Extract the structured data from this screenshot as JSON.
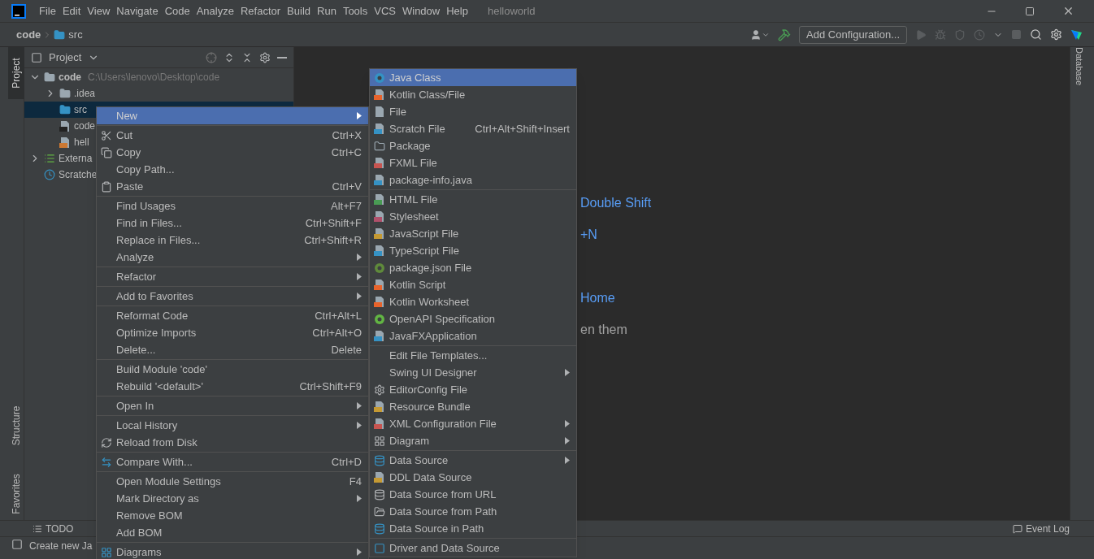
{
  "title_bar": {
    "menus": [
      "File",
      "Edit",
      "View",
      "Navigate",
      "Code",
      "Analyze",
      "Refactor",
      "Build",
      "Run",
      "Tools",
      "VCS",
      "Window",
      "Help"
    ],
    "title": "helloworld"
  },
  "nav_bar": {
    "breadcrumbs": [
      "code",
      "src"
    ],
    "run_config": "Add Configuration..."
  },
  "left_stripe": [
    {
      "label": "Project",
      "selected": true
    },
    {
      "label": "Structure",
      "selected": false
    },
    {
      "label": "Favorites",
      "selected": false
    }
  ],
  "right_stripe": [
    {
      "label": "Database",
      "selected": false
    }
  ],
  "project_panel": {
    "title": "Project",
    "tree": [
      {
        "kind": "module",
        "label": "code",
        "path": "C:\\Users\\lenovo\\Desktop\\code",
        "expanded": true,
        "selected": false,
        "children": [
          {
            "kind": "folder",
            "label": ".idea",
            "expanded": false,
            "selected": false
          },
          {
            "kind": "source",
            "label": "src",
            "selected": true
          },
          {
            "kind": "iml",
            "label": "code",
            "selected": false
          },
          {
            "kind": "java",
            "label": "hell",
            "selected": false
          }
        ]
      },
      {
        "kind": "libraries",
        "label": "Externa",
        "expanded": false,
        "selected": false
      },
      {
        "kind": "scratches",
        "label": "Scratche",
        "selected": false
      }
    ]
  },
  "editor_hints": [
    {
      "kind": "shortcut",
      "text": "Double Shift"
    },
    {
      "kind": "shortcut",
      "text": "+N"
    },
    {
      "kind": "shortcut",
      "text": "Home"
    },
    {
      "kind": "plain",
      "text": "en them"
    }
  ],
  "bottom_bar": {
    "tabs": [
      "TODO"
    ],
    "event_log": "Event Log"
  },
  "status_bar": {
    "message": "Create new Ja"
  },
  "context_menu": {
    "groups": [
      [
        {
          "label": "New",
          "submenu": true,
          "selected": true
        }
      ],
      [
        {
          "label": "Cut",
          "shortcut": "Ctrl+X",
          "selected": false
        },
        {
          "label": "Copy",
          "shortcut": "Ctrl+C",
          "selected": false
        },
        {
          "label": "Copy Path...",
          "selected": false
        },
        {
          "label": "Paste",
          "shortcut": "Ctrl+V",
          "selected": false
        }
      ],
      [
        {
          "label": "Find Usages",
          "shortcut": "Alt+F7",
          "selected": false
        },
        {
          "label": "Find in Files...",
          "shortcut": "Ctrl+Shift+F",
          "selected": false
        },
        {
          "label": "Replace in Files...",
          "shortcut": "Ctrl+Shift+R",
          "selected": false
        },
        {
          "label": "Analyze",
          "submenu": true,
          "selected": false
        }
      ],
      [
        {
          "label": "Refactor",
          "submenu": true,
          "selected": false
        }
      ],
      [
        {
          "label": "Add to Favorites",
          "submenu": true,
          "selected": false
        }
      ],
      [
        {
          "label": "Reformat Code",
          "shortcut": "Ctrl+Alt+L",
          "selected": false
        },
        {
          "label": "Optimize Imports",
          "shortcut": "Ctrl+Alt+O",
          "selected": false
        },
        {
          "label": "Delete...",
          "shortcut": "Delete",
          "selected": false
        }
      ],
      [
        {
          "label": "Build Module 'code'",
          "selected": false
        },
        {
          "label": "Rebuild '<default>'",
          "shortcut": "Ctrl+Shift+F9",
          "selected": false
        }
      ],
      [
        {
          "label": "Open In",
          "submenu": true,
          "selected": false
        }
      ],
      [
        {
          "label": "Local History",
          "submenu": true,
          "selected": false
        },
        {
          "label": "Reload from Disk",
          "selected": false
        }
      ],
      [
        {
          "label": "Compare With...",
          "shortcut": "Ctrl+D",
          "selected": false
        }
      ],
      [
        {
          "label": "Open Module Settings",
          "shortcut": "F4",
          "selected": false
        },
        {
          "label": "Mark Directory as",
          "submenu": true,
          "selected": false
        },
        {
          "label": "Remove BOM",
          "selected": false
        },
        {
          "label": "Add BOM",
          "selected": false
        }
      ],
      [
        {
          "label": "Diagrams",
          "submenu": true,
          "selected": false
        }
      ]
    ]
  },
  "new_submenu": {
    "groups": [
      [
        {
          "label": "Java Class",
          "selected": true
        },
        {
          "label": "Kotlin Class/File",
          "selected": false
        },
        {
          "label": "File",
          "selected": false
        },
        {
          "label": "Scratch File",
          "shortcut": "Ctrl+Alt+Shift+Insert",
          "selected": false
        },
        {
          "label": "Package",
          "selected": false
        },
        {
          "label": "FXML File",
          "selected": false
        },
        {
          "label": "package-info.java",
          "selected": false
        }
      ],
      [
        {
          "label": "HTML File",
          "selected": false
        },
        {
          "label": "Stylesheet",
          "selected": false
        },
        {
          "label": "JavaScript File",
          "selected": false
        },
        {
          "label": "TypeScript File",
          "selected": false
        },
        {
          "label": "package.json File",
          "selected": false
        },
        {
          "label": "Kotlin Script",
          "selected": false
        },
        {
          "label": "Kotlin Worksheet",
          "selected": false
        },
        {
          "label": "OpenAPI Specification",
          "selected": false
        },
        {
          "label": "JavaFXApplication",
          "selected": false
        }
      ],
      [
        {
          "label": "Edit File Templates...",
          "selected": false
        },
        {
          "label": "Swing UI Designer",
          "submenu": true,
          "selected": false
        },
        {
          "label": "EditorConfig File",
          "selected": false
        },
        {
          "label": "Resource Bundle",
          "selected": false
        },
        {
          "label": "XML Configuration File",
          "submenu": true,
          "selected": false
        },
        {
          "label": "Diagram",
          "submenu": true,
          "selected": false
        }
      ],
      [
        {
          "label": "Data Source",
          "submenu": true,
          "selected": false
        },
        {
          "label": "DDL Data Source",
          "selected": false
        },
        {
          "label": "Data Source from URL",
          "selected": false
        },
        {
          "label": "Data Source from Path",
          "selected": false
        },
        {
          "label": "Data Source in Path",
          "selected": false
        }
      ],
      [
        {
          "label": "Driver and Data Source",
          "selected": false
        }
      ]
    ]
  }
}
